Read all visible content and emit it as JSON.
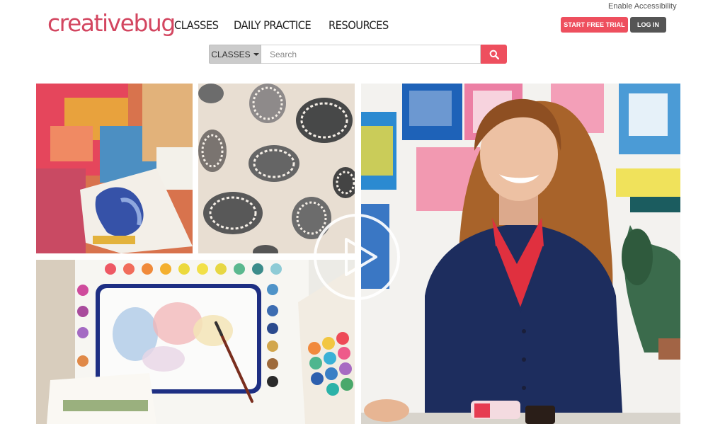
{
  "accessibility": "Enable Accessibility",
  "logo": "creativebug",
  "nav": {
    "classes": "CLASSES",
    "daily": "DAILY PRACTICE",
    "resources": "RESOURCES"
  },
  "header": {
    "trial": "START FREE TRIAL",
    "login": "LOG IN"
  },
  "search": {
    "category": "CLASSES",
    "placeholder": "Search"
  },
  "colors": {
    "brand": "#d34660",
    "accent": "#ee4f5e",
    "login": "#555555"
  },
  "icons": [
    "search-icon",
    "play-icon",
    "chevron-down-icon"
  ]
}
